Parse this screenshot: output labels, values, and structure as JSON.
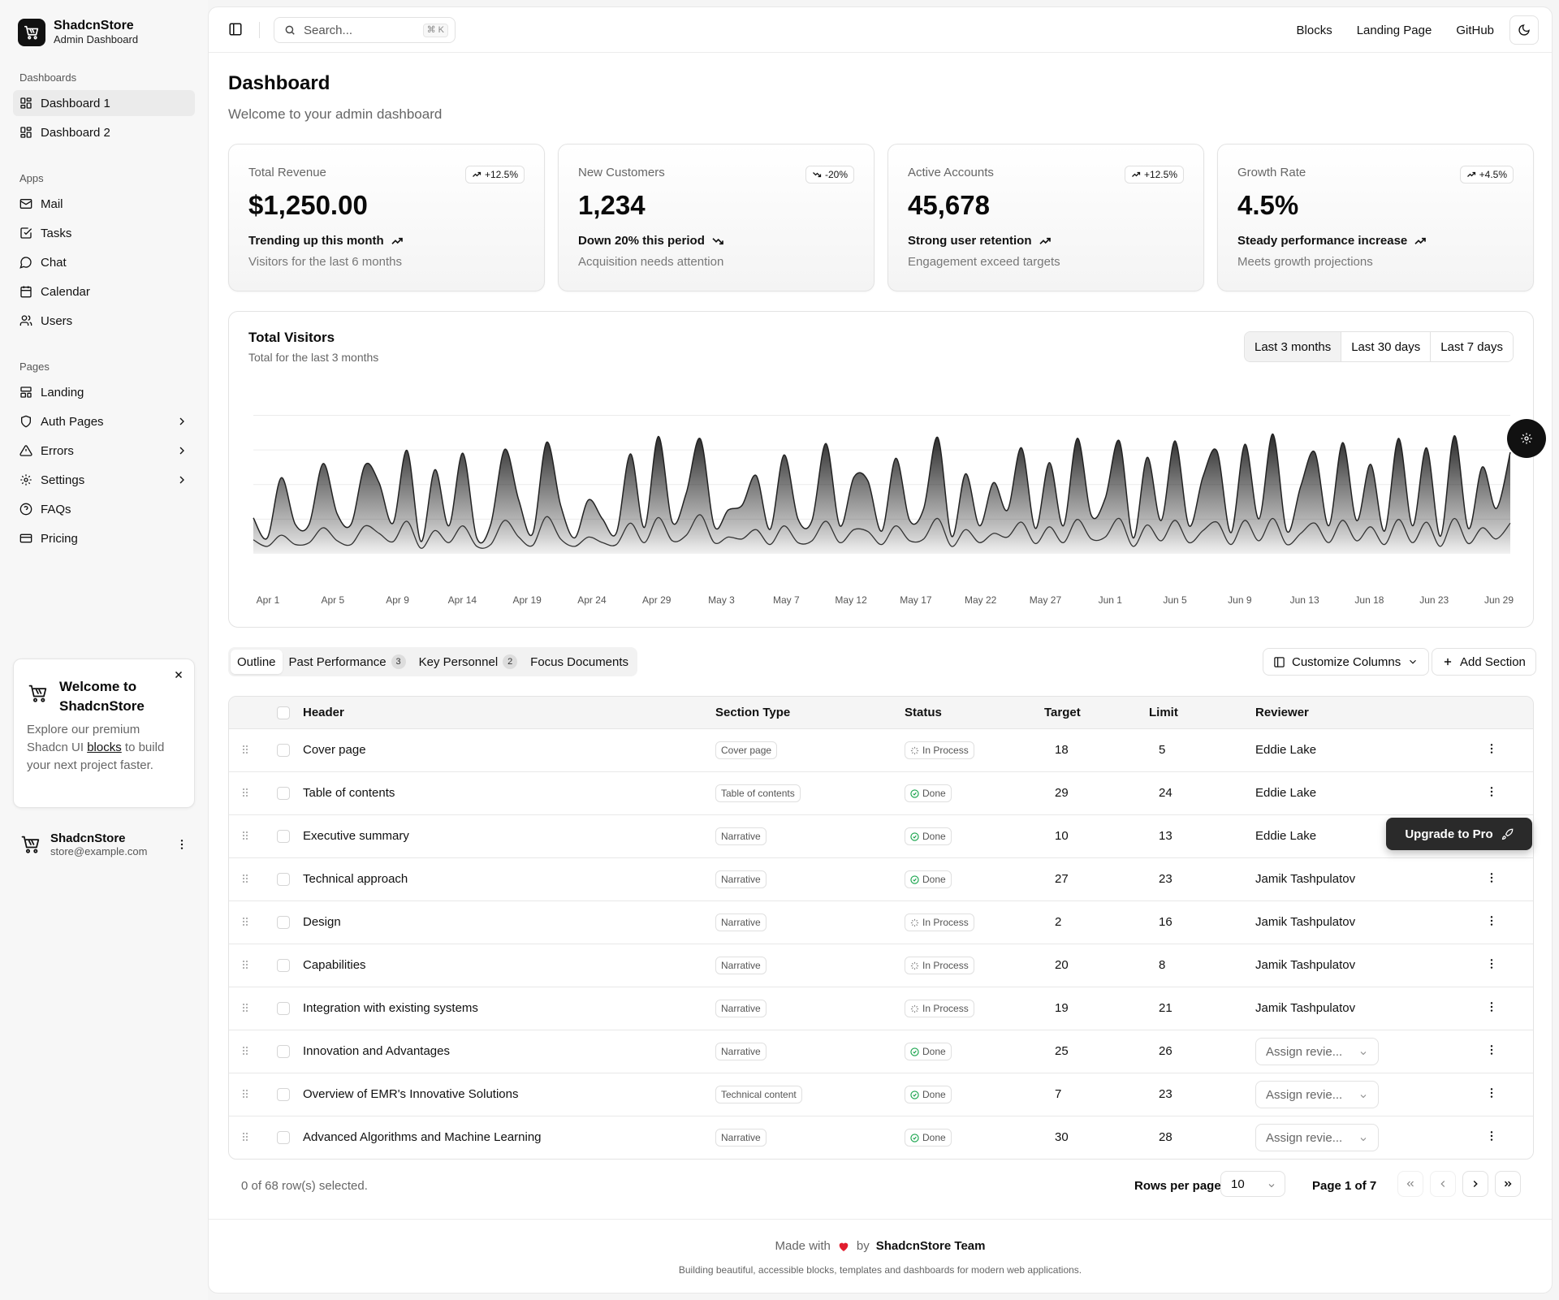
{
  "brand": {
    "name": "ShadcnStore",
    "subtitle": "Admin Dashboard"
  },
  "sidebar": {
    "groups": [
      {
        "label": "Dashboards",
        "items": [
          {
            "label": "Dashboard 1",
            "icon": "layout-dashboard-icon",
            "active": true
          },
          {
            "label": "Dashboard 2",
            "icon": "layout-dashboard-icon"
          }
        ]
      },
      {
        "label": "Apps",
        "items": [
          {
            "label": "Mail",
            "icon": "mail-icon"
          },
          {
            "label": "Tasks",
            "icon": "checkbox-icon"
          },
          {
            "label": "Chat",
            "icon": "chat-bubble-icon"
          },
          {
            "label": "Calendar",
            "icon": "calendar-icon"
          },
          {
            "label": "Users",
            "icon": "users-icon"
          }
        ]
      },
      {
        "label": "Pages",
        "items": [
          {
            "label": "Landing",
            "icon": "layout-icon"
          },
          {
            "label": "Auth Pages",
            "icon": "shield-icon",
            "expandable": true
          },
          {
            "label": "Errors",
            "icon": "alert-triangle-icon",
            "expandable": true
          },
          {
            "label": "Settings",
            "icon": "gear-icon",
            "expandable": true
          },
          {
            "label": "FAQs",
            "icon": "help-circle-icon"
          },
          {
            "label": "Pricing",
            "icon": "credit-card-icon"
          }
        ]
      }
    ],
    "promo": {
      "title": "Welcome to ShadcnStore",
      "text_before": "Explore our premium Shadcn UI ",
      "link": "blocks",
      "text_after": " to build your next project faster."
    },
    "user": {
      "name": "ShadcnStore",
      "email": "store@example.com"
    }
  },
  "topbar": {
    "search_placeholder": "Search...",
    "search_shortcut": "⌘ K",
    "links": [
      "Blocks",
      "Landing Page",
      "GitHub"
    ]
  },
  "page": {
    "title": "Dashboard",
    "subtitle": "Welcome to your admin dashboard"
  },
  "stats": [
    {
      "label": "Total Revenue",
      "badge": "+12.5%",
      "direction": "up",
      "value": "$1,250.00",
      "trend": "Trending up this month",
      "foot": "Visitors for the last 6 months"
    },
    {
      "label": "New Customers",
      "badge": "-20%",
      "direction": "down",
      "value": "1,234",
      "trend": "Down 20% this period",
      "foot": "Acquisition needs attention"
    },
    {
      "label": "Active Accounts",
      "badge": "+12.5%",
      "direction": "up",
      "value": "45,678",
      "trend": "Strong user retention",
      "foot": "Engagement exceed targets"
    },
    {
      "label": "Growth Rate",
      "badge": "+4.5%",
      "direction": "up",
      "value": "4.5%",
      "trend": "Steady performance increase",
      "foot": "Meets growth projections"
    }
  ],
  "chart_card": {
    "title": "Total Visitors",
    "subtitle": "Total for the last 3 months",
    "ranges": [
      "Last 3 months",
      "Last 30 days",
      "Last 7 days"
    ],
    "active_range": "Last 3 months"
  },
  "chart_data": {
    "type": "area",
    "x_tick_labels": [
      "Apr 1",
      "Apr 5",
      "Apr 9",
      "Apr 14",
      "Apr 19",
      "Apr 24",
      "Apr 29",
      "May 3",
      "May 7",
      "May 12",
      "May 17",
      "May 22",
      "May 27",
      "Jun 1",
      "Jun 5",
      "Jun 9",
      "Jun 13",
      "Jun 18",
      "Jun 23",
      "Jun 29"
    ],
    "stacked": true,
    "grid": true,
    "y_axis_visible": false,
    "ylim": [
      0,
      1
    ],
    "series": [
      {
        "values": [
          0.13,
          0.05,
          0.34,
          0.12,
          0.11,
          0.38,
          0.16,
          0.12,
          0.36,
          0.3,
          0.11,
          0.42,
          0.04,
          0.36,
          0.1,
          0.43,
          0.05,
          0.12,
          0.42,
          0.22,
          0.07,
          0.44,
          0.2,
          0.05,
          0.22,
          0.14,
          0.07,
          0.41,
          0.09,
          0.48,
          0.11,
          0.25,
          0.45,
          0.1,
          0.16,
          0.2,
          0.32,
          0.09,
          0.42,
          0.14,
          0.12,
          0.46,
          0.1,
          0.31,
          0.3,
          0.08,
          0.4,
          0.12,
          0.18,
          0.48,
          0.06,
          0.33,
          0.1,
          0.3,
          0.16,
          0.44,
          0.09,
          0.38,
          0.1,
          0.48,
          0.14,
          0.23,
          0.46,
          0.05,
          0.4,
          0.12,
          0.47,
          0.1,
          0.32,
          0.42,
          0.07,
          0.45,
          0.13,
          0.5,
          0.08,
          0.28,
          0.42,
          0.1,
          0.46,
          0.12,
          0.37,
          0.08,
          0.48,
          0.1,
          0.44,
          0.06,
          0.49,
          0.09,
          0.36,
          0.18,
          0.42
        ]
      },
      {
        "values": [
          0.15,
          0.08,
          0.2,
          0.1,
          0.12,
          0.28,
          0.14,
          0.1,
          0.3,
          0.22,
          0.13,
          0.35,
          0.06,
          0.25,
          0.12,
          0.3,
          0.08,
          0.1,
          0.36,
          0.18,
          0.09,
          0.4,
          0.16,
          0.08,
          0.18,
          0.12,
          0.1,
          0.33,
          0.12,
          0.39,
          0.14,
          0.2,
          0.42,
          0.12,
          0.18,
          0.16,
          0.26,
          0.1,
          0.3,
          0.12,
          0.14,
          0.35,
          0.12,
          0.26,
          0.24,
          0.1,
          0.3,
          0.14,
          0.16,
          0.38,
          0.08,
          0.26,
          0.12,
          0.22,
          0.18,
          0.34,
          0.11,
          0.29,
          0.12,
          0.37,
          0.16,
          0.18,
          0.38,
          0.08,
          0.31,
          0.14,
          0.36,
          0.12,
          0.25,
          0.34,
          0.1,
          0.36,
          0.14,
          0.38,
          0.1,
          0.22,
          0.33,
          0.12,
          0.36,
          0.14,
          0.29,
          0.1,
          0.37,
          0.12,
          0.34,
          0.08,
          0.38,
          0.11,
          0.28,
          0.16,
          0.33
        ]
      }
    ]
  },
  "tabs": [
    {
      "label": "Outline",
      "active": true
    },
    {
      "label": "Past Performance",
      "count": "3"
    },
    {
      "label": "Key Personnel",
      "count": "2"
    },
    {
      "label": "Focus Documents"
    }
  ],
  "toolbar": {
    "customize": "Customize Columns",
    "add_section": "Add Section"
  },
  "table": {
    "columns": [
      "Header",
      "Section Type",
      "Status",
      "Target",
      "Limit",
      "Reviewer"
    ],
    "rows": [
      {
        "header": "Cover page",
        "type": "Cover page",
        "status": "In Process",
        "target": "18",
        "limit": "5",
        "reviewer": "Eddie Lake"
      },
      {
        "header": "Table of contents",
        "type": "Table of contents",
        "status": "Done",
        "target": "29",
        "limit": "24",
        "reviewer": "Eddie Lake"
      },
      {
        "header": "Executive summary",
        "type": "Narrative",
        "status": "Done",
        "target": "10",
        "limit": "13",
        "reviewer": "Eddie Lake"
      },
      {
        "header": "Technical approach",
        "type": "Narrative",
        "status": "Done",
        "target": "27",
        "limit": "23",
        "reviewer": "Jamik Tashpulatov"
      },
      {
        "header": "Design",
        "type": "Narrative",
        "status": "In Process",
        "target": "2",
        "limit": "16",
        "reviewer": "Jamik Tashpulatov"
      },
      {
        "header": "Capabilities",
        "type": "Narrative",
        "status": "In Process",
        "target": "20",
        "limit": "8",
        "reviewer": "Jamik Tashpulatov"
      },
      {
        "header": "Integration with existing systems",
        "type": "Narrative",
        "status": "In Process",
        "target": "19",
        "limit": "21",
        "reviewer": "Jamik Tashpulatov"
      },
      {
        "header": "Innovation and Advantages",
        "type": "Narrative",
        "status": "Done",
        "target": "25",
        "limit": "26",
        "reviewer": ""
      },
      {
        "header": "Overview of EMR's Innovative Solutions",
        "type": "Technical content",
        "status": "Done",
        "target": "7",
        "limit": "23",
        "reviewer": ""
      },
      {
        "header": "Advanced Algorithms and Machine Learning",
        "type": "Narrative",
        "status": "Done",
        "target": "30",
        "limit": "28",
        "reviewer": ""
      }
    ],
    "assign_placeholder": "Assign revie..."
  },
  "upgrade_label": "Upgrade to Pro",
  "pagination": {
    "selected_text": "0 of 68 row(s) selected.",
    "rows_per_page_label": "Rows per page",
    "rows_per_page": "10",
    "page_text": "Page 1 of 7"
  },
  "footer": {
    "made_with": "Made with",
    "by": "by",
    "team": "ShadcnStore Team",
    "tagline": "Building beautiful, accessible blocks, templates and dashboards for modern web applications."
  },
  "colors": {
    "heart": "#e11d2e",
    "done": "#16a34a",
    "dark": "#111111"
  }
}
